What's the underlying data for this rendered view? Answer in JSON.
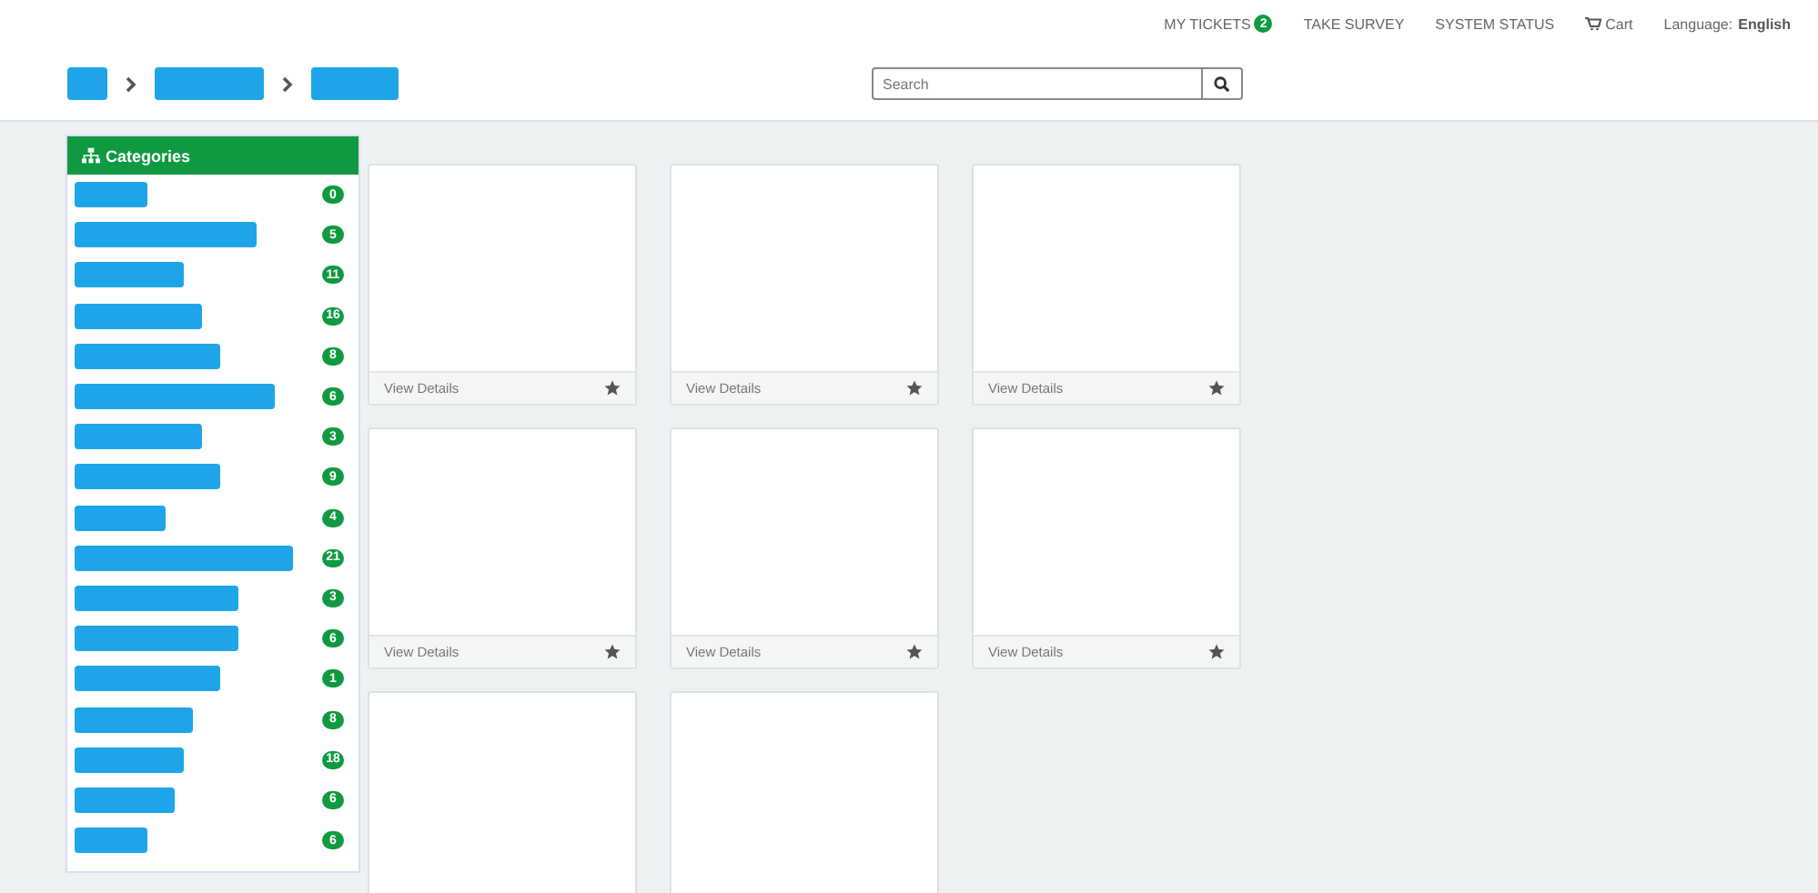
{
  "top_nav": {
    "my_tickets": {
      "label": "MY TICKETS",
      "badge": "2"
    },
    "links": [
      "TAKE SURVEY",
      "SYSTEM STATUS"
    ],
    "cart": "Cart",
    "language": {
      "label": "Language:",
      "value": "English"
    }
  },
  "search": {
    "placeholder": "Search"
  },
  "sidebar": {
    "title": "Categories",
    "items": [
      {
        "count": "0"
      },
      {
        "count": "5"
      },
      {
        "count": "11"
      },
      {
        "count": "16"
      },
      {
        "count": "8"
      },
      {
        "count": "6"
      },
      {
        "count": "3"
      },
      {
        "count": "9"
      },
      {
        "count": "4"
      },
      {
        "count": "21"
      },
      {
        "count": "3"
      },
      {
        "count": "6"
      },
      {
        "count": "1"
      },
      {
        "count": "8"
      },
      {
        "count": "18"
      },
      {
        "count": "6"
      },
      {
        "count": "6"
      }
    ]
  },
  "cards": [
    {
      "kind": "full",
      "footer": "View Details"
    },
    {
      "kind": "full",
      "footer": "View Details"
    },
    {
      "kind": "full",
      "footer": "View Details"
    },
    {
      "kind": "full",
      "footer": "View Details"
    },
    {
      "kind": "full",
      "footer": "View Details"
    },
    {
      "kind": "full",
      "footer": "View Details"
    },
    {
      "kind": "cut"
    },
    {
      "kind": "cut"
    }
  ]
}
